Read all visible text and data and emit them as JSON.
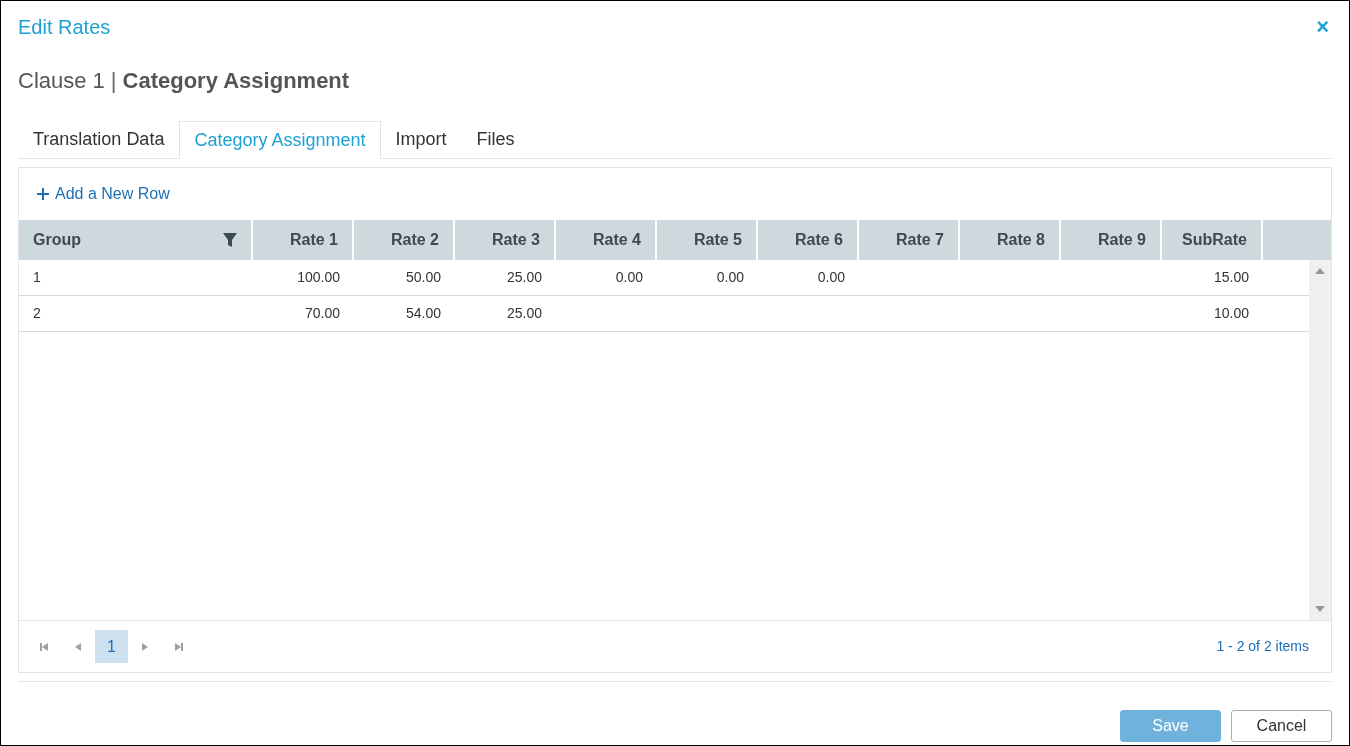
{
  "window": {
    "title": "Edit Rates",
    "close": "×"
  },
  "heading": {
    "prefix": "Clause 1",
    "separator": "|",
    "title": "Category Assignment"
  },
  "tabs": [
    {
      "label": "Translation Data",
      "selected": false
    },
    {
      "label": "Category Assignment",
      "selected": true
    },
    {
      "label": "Import",
      "selected": false
    },
    {
      "label": "Files",
      "selected": false
    }
  ],
  "toolbar": {
    "add_row": "Add a New Row"
  },
  "table": {
    "columns": [
      {
        "label": "Group",
        "filter": true
      },
      {
        "label": "Rate 1",
        "filter": false
      },
      {
        "label": "Rate 2",
        "filter": false
      },
      {
        "label": "Rate 3",
        "filter": false
      },
      {
        "label": "Rate 4",
        "filter": false
      },
      {
        "label": "Rate 5",
        "filter": false
      },
      {
        "label": "Rate 6",
        "filter": false
      },
      {
        "label": "Rate 7",
        "filter": false
      },
      {
        "label": "Rate 8",
        "filter": false
      },
      {
        "label": "Rate 9",
        "filter": false
      },
      {
        "label": "SubRate",
        "filter": false
      }
    ],
    "rows": [
      [
        "1",
        "100.00",
        "50.00",
        "25.00",
        "0.00",
        "0.00",
        "0.00",
        null,
        null,
        null,
        "15.00"
      ],
      [
        "2",
        "70.00",
        "54.00",
        "25.00",
        null,
        null,
        null,
        null,
        null,
        null,
        "10.00"
      ]
    ]
  },
  "pager": {
    "pages": [
      {
        "label": "1",
        "selected": true
      }
    ],
    "summary": "1 - 2 of 2 items"
  },
  "buttons": [
    {
      "label": "Save",
      "kind": "primary",
      "disabled": true
    },
    {
      "label": "Cancel",
      "kind": "secondary",
      "disabled": false
    }
  ]
}
